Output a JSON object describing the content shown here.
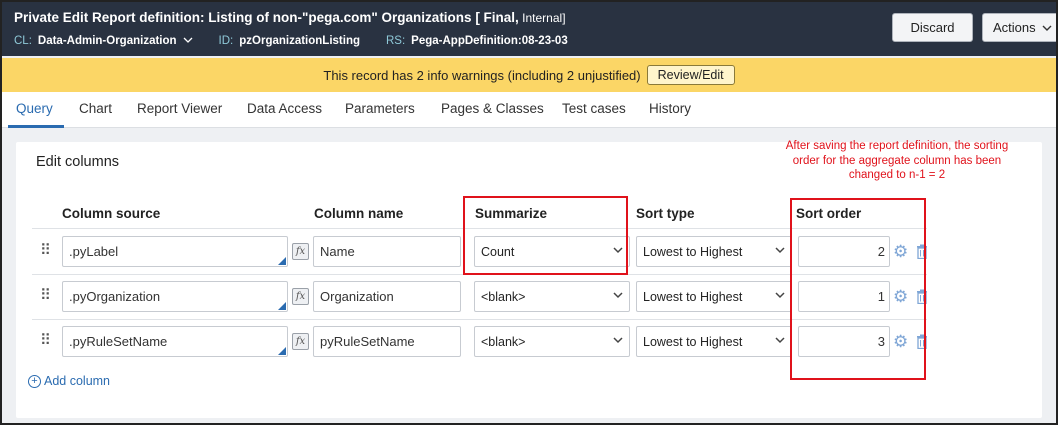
{
  "header": {
    "title_bold": "Private Edit  Report definition: Listing of non-\"pega.com\" Organizations [ Final,",
    "title_tail": " Internal]",
    "meta": {
      "cl_key": "CL:",
      "cl_val": "Data-Admin-Organization",
      "id_key": "ID:",
      "id_val": "pzOrganizationListing",
      "rs_key": "RS:",
      "rs_val": "Pega-AppDefinition:08-23-03"
    },
    "discard_label": "Discard",
    "actions_label": "Actions"
  },
  "warning": {
    "text": "This record has 2 info warnings (including 2 unjustified)",
    "button": "Review/Edit"
  },
  "tabs": [
    "Query",
    "Chart",
    "Report Viewer",
    "Data Access",
    "Parameters",
    "Pages & Classes",
    "Test cases",
    "History"
  ],
  "editor": {
    "title": "Edit columns",
    "headers": {
      "column_source": "Column source",
      "column_name": "Column name",
      "summarize": "Summarize",
      "sort_type": "Sort type",
      "sort_order": "Sort order"
    },
    "rows": [
      {
        "source": ".pyLabel",
        "name": "Name",
        "summarize": "Count",
        "sort_type": "Lowest to Highest",
        "sort_order": "2"
      },
      {
        "source": ".pyOrganization",
        "name": "Organization",
        "summarize": "<blank>",
        "sort_type": "Lowest to Highest",
        "sort_order": "1"
      },
      {
        "source": ".pyRuleSetName",
        "name": "pyRuleSetName",
        "summarize": "<blank>",
        "sort_type": "Lowest to Highest",
        "sort_order": "3"
      }
    ],
    "add_column": "Add column"
  },
  "annotation": "After saving the report definition, the sorting order for the aggregate column has been changed to n-1 = 2",
  "colors": {
    "header_bg": "#293241",
    "warning_bg": "#fbd666",
    "accent": "#2a6bb0",
    "annotation_red": "#e0121b"
  }
}
